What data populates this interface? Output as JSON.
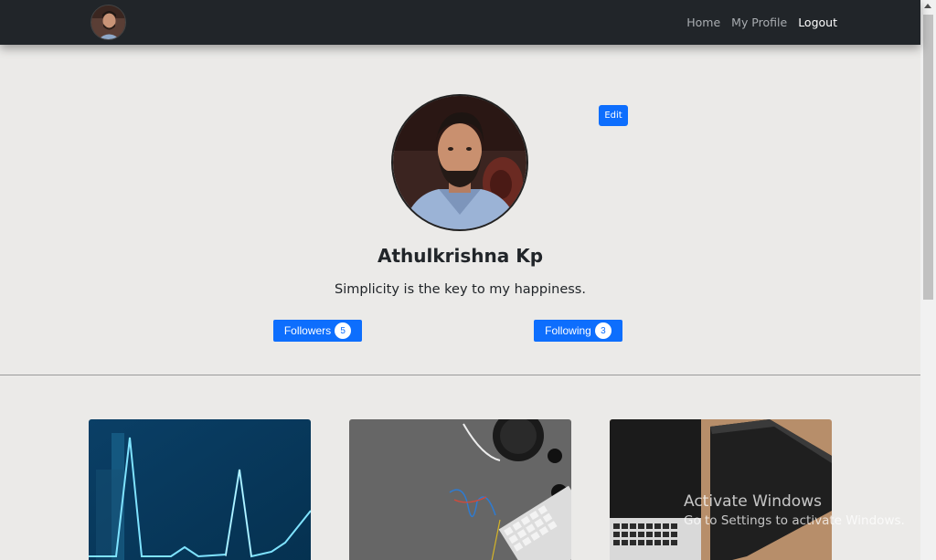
{
  "nav": {
    "links": {
      "home": "Home",
      "my_profile": "My Profile",
      "logout": "Logout"
    }
  },
  "profile": {
    "edit_label": "Edit",
    "name": "Athulkrishna Kp",
    "bio": "Simplicity is the key to my happiness.",
    "followers_label": "Followers",
    "followers_count": "5",
    "following_label": "Following",
    "following_count": "3"
  },
  "watermark": {
    "title": "Activate Windows",
    "subtitle": "Go to Settings to activate Windows."
  },
  "colors": {
    "navbar": "#212529",
    "primary": "#0d6efd",
    "background": "#ebeae8"
  }
}
